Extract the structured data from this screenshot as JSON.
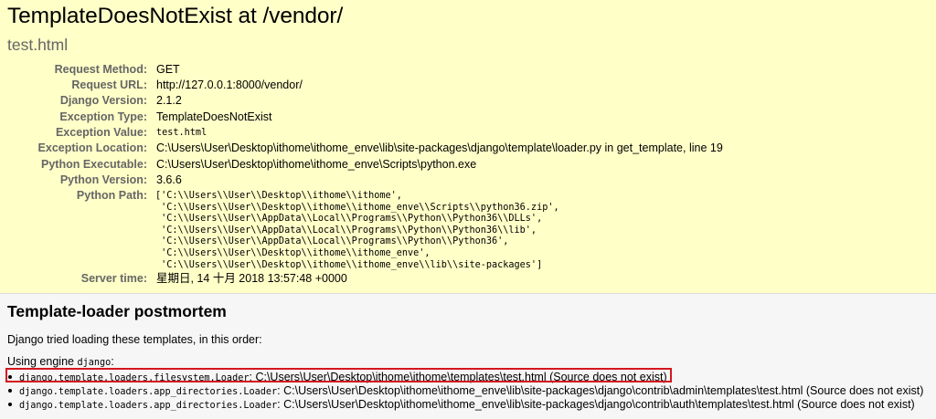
{
  "summary": {
    "title": "TemplateDoesNotExist at /vendor/",
    "subtitle": "test.html",
    "rows": [
      {
        "label": "Request Method:",
        "value": "GET"
      },
      {
        "label": "Request URL:",
        "value": "http://127.0.0.1:8000/vendor/"
      },
      {
        "label": "Django Version:",
        "value": "2.1.2"
      },
      {
        "label": "Exception Type:",
        "value": "TemplateDoesNotExist"
      },
      {
        "label": "Exception Value:",
        "value": "test.html"
      },
      {
        "label": "Exception Location:",
        "value": "C:\\Users\\User\\Desktop\\ithome\\ithome_enve\\lib\\site-packages\\django\\template\\loader.py in get_template, line 19"
      },
      {
        "label": "Python Executable:",
        "value": "C:\\Users\\User\\Desktop\\ithome\\ithome_enve\\Scripts\\python.exe"
      },
      {
        "label": "Python Version:",
        "value": "3.6.6"
      },
      {
        "label": "Python Path:",
        "value": "['C:\\\\Users\\\\User\\\\Desktop\\\\ithome\\\\ithome',\n 'C:\\\\Users\\\\User\\\\Desktop\\\\ithome\\\\ithome_enve\\\\Scripts\\\\python36.zip',\n 'C:\\\\Users\\\\User\\\\AppData\\\\Local\\\\Programs\\\\Python\\\\Python36\\\\DLLs',\n 'C:\\\\Users\\\\User\\\\AppData\\\\Local\\\\Programs\\\\Python\\\\Python36\\\\lib',\n 'C:\\\\Users\\\\User\\\\AppData\\\\Local\\\\Programs\\\\Python\\\\Python36',\n 'C:\\\\Users\\\\User\\\\Desktop\\\\ithome\\\\ithome_enve',\n 'C:\\\\Users\\\\User\\\\Desktop\\\\ithome\\\\ithome_enve\\\\lib\\\\site-packages']"
      },
      {
        "label": "Server time:",
        "value": "星期日, 14 十月 2018 13:57:48 +0000"
      }
    ]
  },
  "postmortem": {
    "heading": "Template-loader postmortem",
    "intro": "Django tried loading these templates, in this order:",
    "engine_prefix": "Using engine ",
    "engine_name": "django",
    "engine_suffix": ":",
    "loaders": [
      {
        "loader": "django.template.loaders.filesystem.Loader",
        "separator": ": ",
        "detail": "C:\\Users\\User\\Desktop\\ithome\\ithome\\templates\\test.html (Source does not exist)",
        "highlighted": true
      },
      {
        "loader": "django.template.loaders.app_directories.Loader",
        "separator": ": ",
        "detail": "C:\\Users\\User\\Desktop\\ithome\\ithome_enve\\lib\\site-packages\\django\\contrib\\admin\\templates\\test.html (Source does not exist)",
        "highlighted": false
      },
      {
        "loader": "django.template.loaders.app_directories.Loader",
        "separator": ": ",
        "detail": "C:\\Users\\User\\Desktop\\ithome\\ithome_enve\\lib\\site-packages\\django\\contrib\\auth\\templates\\test.html (Source does not exist)",
        "highlighted": false
      }
    ]
  },
  "colors": {
    "summary_background": "#ffffc8",
    "label_color": "#666666",
    "subtitle_color": "#666666",
    "postmortem_background": "#f6f6f6",
    "highlight_border": "#d4161f"
  }
}
